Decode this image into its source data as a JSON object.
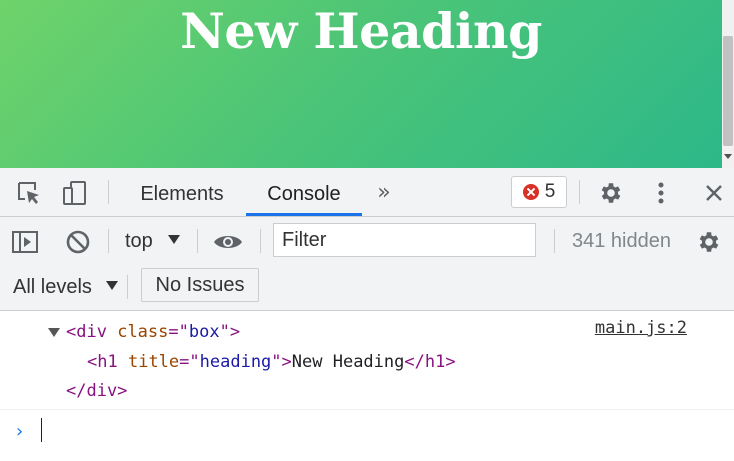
{
  "page": {
    "heading": "New Heading"
  },
  "devtools": {
    "tabs": [
      {
        "label": "Elements"
      },
      {
        "label": "Console"
      }
    ],
    "more_tabs_icon": "double-chevron-icon",
    "error_count": "5",
    "toolbar": {
      "context": "top",
      "filter_placeholder": "Filter",
      "hidden_count": "341 hidden"
    },
    "levels": {
      "label": "All levels",
      "issues_button": "No Issues"
    },
    "console": {
      "source": "main.js:2",
      "line1": {
        "open": "<div",
        "attr": "class",
        "eq": "=\"",
        "value": "box",
        "close": "\">"
      },
      "line2": {
        "open": "<h1",
        "attr": "title",
        "eq": "=\"",
        "value": "heading",
        "close": "\">",
        "text": "New Heading",
        "end": "</h1>"
      },
      "line3": "</div>",
      "prompt": "›"
    },
    "colors": {
      "accent": "#1a73e8",
      "error": "#d93025",
      "gradient_start": "#6fd36a",
      "gradient_end": "#2db889"
    }
  }
}
